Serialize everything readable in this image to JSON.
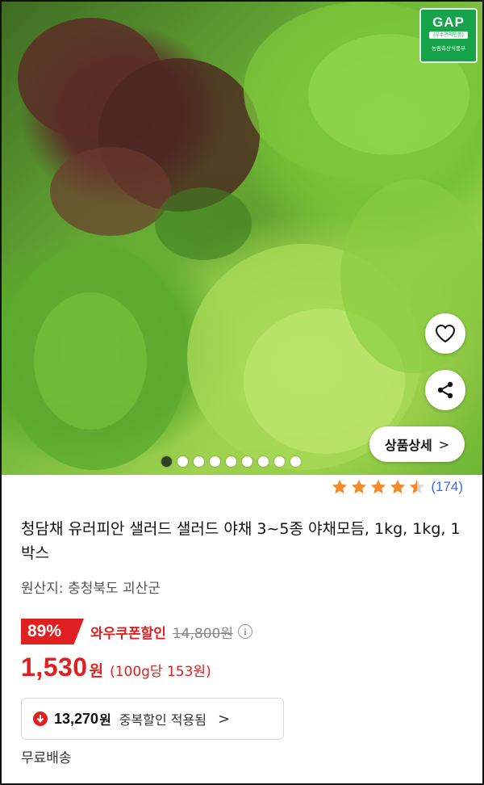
{
  "gallery": {
    "badge": {
      "title": "GAP",
      "subtitle": "(우수관리인증)",
      "footer": "농림축산식품부"
    },
    "detail_button_label": "상품상세",
    "detail_button_chevron": ">",
    "dot_count": 9,
    "active_dot": 0,
    "wishlist_icon": "heart-icon",
    "share_icon": "share-icon"
  },
  "rating": {
    "stars": 4.5,
    "max_stars": 5,
    "review_count": "(174)",
    "star_color": "#f7892b"
  },
  "product": {
    "title": "청담채 유러피안 샐러드 샐러드 야채 3~5종 야채모듬, 1kg, 1kg, 1박스",
    "origin": "원산지: 충청북도 괴산군"
  },
  "pricing": {
    "discount_percent": "89%",
    "coupon_label": "와우쿠폰할인",
    "original_price": "14,800원",
    "info_icon": "i",
    "price": "1,530",
    "price_unit": "원",
    "unit_price": "(100g당 153원)",
    "accent_color": "#e02020"
  },
  "extra_discount": {
    "amount": "13,270",
    "amount_unit": "원",
    "label": "중복할인 적용됨",
    "chevron": ">"
  },
  "shipping": {
    "label": "무료배송"
  }
}
